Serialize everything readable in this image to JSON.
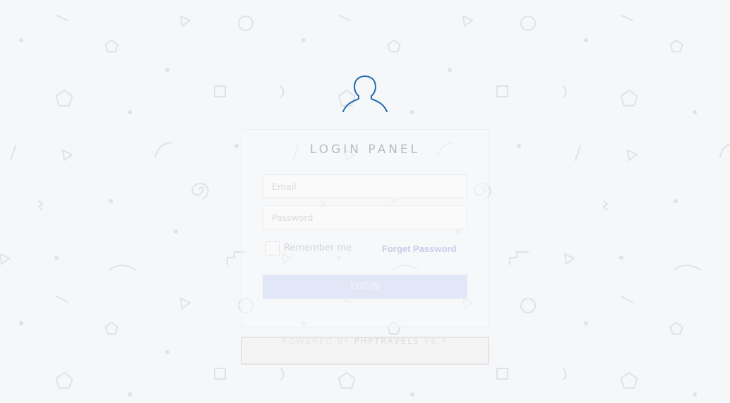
{
  "login": {
    "title": "LOGIN PANEL",
    "email_placeholder": "Email",
    "password_placeholder": "Password",
    "remember_label": "Remember me",
    "remember_checked": false,
    "forget_label": "Forget Password",
    "login_label": "LOGIN"
  },
  "footer": {
    "powered_prefix": "POWERED BY ",
    "brand": "PHPTRAVELS",
    "version": " V6.4"
  },
  "colors": {
    "background": "#f6f7f9",
    "avatar_stroke": "#1e6bb0",
    "button_bg": "#e2e7f7",
    "link": "#c9cde9",
    "pattern": "#dfe2e7"
  },
  "icons": {
    "avatar": "user-outline-icon",
    "background": "geometric-shapes-pattern"
  }
}
